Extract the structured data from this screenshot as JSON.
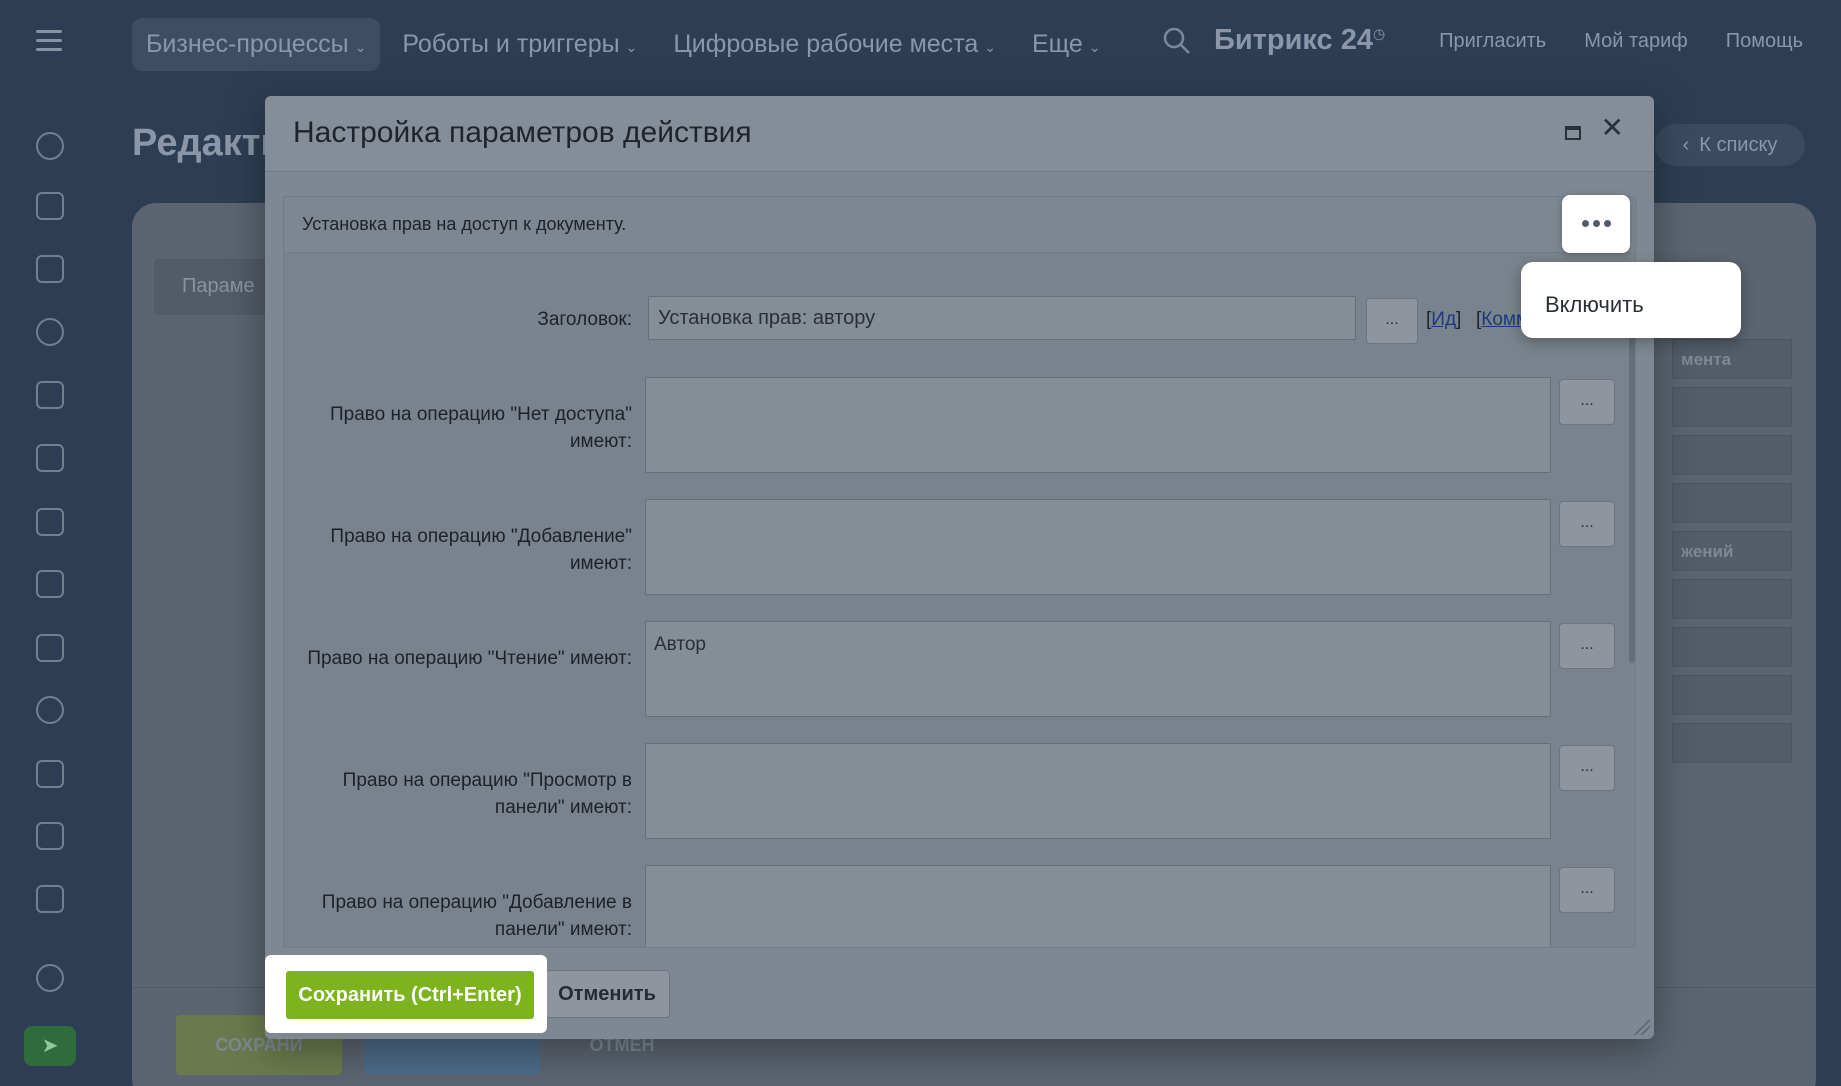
{
  "topbar": {
    "nav": [
      {
        "label": "Бизнес-процессы"
      },
      {
        "label": "Роботы и триггеры"
      },
      {
        "label": "Цифровые рабочие места"
      },
      {
        "label": "Еще"
      }
    ],
    "brand": "Битрикс",
    "brand_num": "24",
    "links": [
      {
        "label": "Пригласить"
      },
      {
        "label": "Мой тариф"
      },
      {
        "label": "Помощь"
      }
    ]
  },
  "background": {
    "title": "Редакти",
    "back_label": "К списку",
    "param_tab": "Параме",
    "row_labels": [
      "мента",
      "",
      "",
      "",
      "жений",
      "",
      "",
      "",
      ""
    ],
    "footer_save": "СОХРАНИ",
    "footer_cancel": "ОТМЕН"
  },
  "dialog": {
    "title": "Настройка параметров действия",
    "description": "Установка прав на доступ к документу.",
    "fields": [
      {
        "label": "Заголовок:",
        "value": "Установка прав: автору"
      },
      {
        "label": "Право на операцию \"Нет доступа\" имеют:",
        "value": ""
      },
      {
        "label": "Право на операцию \"Добавление\" имеют:",
        "value": ""
      },
      {
        "label": "Право на операцию \"Чтение\" имеют:",
        "value": "Автор"
      },
      {
        "label": "Право на операцию \"Просмотр в панели\" имеют:",
        "value": ""
      },
      {
        "label": "Право на операцию \"Добавление в панели\" имеют:",
        "value": ""
      }
    ],
    "dots_label": "...",
    "link_id": "Ид",
    "link_comment": "Комм",
    "save_label": "Сохранить (Ctrl+Enter)",
    "cancel_label": "Отменить"
  },
  "more_menu": {
    "items": [
      {
        "label": "Включить"
      }
    ]
  },
  "colors": {
    "accent_save": "#7cb31e",
    "link": "#1a3a80"
  }
}
